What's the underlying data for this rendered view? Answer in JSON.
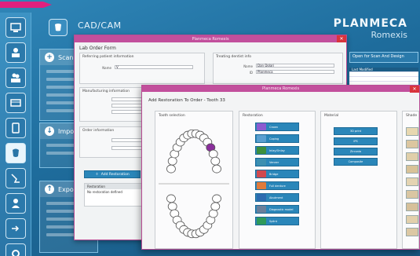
{
  "header": {
    "app_title": "CAD/CAM",
    "brand_line1": "PLANMECA",
    "brand_line2": "Romexis"
  },
  "sections": [
    {
      "label": "Scan"
    },
    {
      "label": "Impo"
    },
    {
      "label": "Expo"
    }
  ],
  "right_panel": {
    "bar_label": "Open for Scan And Design",
    "table_header": "Last Modified",
    "rows": [
      "",
      ""
    ]
  },
  "order_dialog": {
    "title": "Planmeca Romexis",
    "subtitle": "Lab Order Form",
    "group_patient": "Referring patient information",
    "group_patient_field": "Name",
    "group_patient_value": "V",
    "group_dentist": "Treating dentist info",
    "group_dentist_fields": [
      "Name",
      "ID"
    ],
    "group_dentist_values": [
      "Dan Dolari",
      "Planmeca"
    ],
    "group_manufacturing": "Manufacturing information",
    "group_delivery": "Order information",
    "add_button": "Add Restoration",
    "table_header": "Restoration",
    "table_row": "No restoration defined"
  },
  "restoration_dialog": {
    "title": "Planmeca Romexis",
    "subtitle": "Add Restoration To Order - Tooth 33",
    "col_tooth": "Tooth selection",
    "col_restoration": "Restoration",
    "col_material": "Material",
    "col_shade": "Shade",
    "restorations": [
      {
        "label": "Crown",
        "color": "#8c5bd0"
      },
      {
        "label": "Coping",
        "color": "#5a9fd0"
      },
      {
        "label": "Inlay/Onlay",
        "color": "#3c8f3c"
      },
      {
        "label": "Veneer",
        "color": "#3c8fb0"
      },
      {
        "label": "Bridge",
        "color": "#d0494f"
      },
      {
        "label": "Full denture",
        "color": "#e07a3a"
      },
      {
        "label": "Abutment",
        "color": "#2c6bb0"
      },
      {
        "label": "Diagnostic model",
        "color": "#6a7f9a"
      },
      {
        "label": "Splint",
        "color": "#2f9a5a"
      }
    ],
    "materials": [
      "3D print",
      "IPS",
      "Zirconia",
      "Composite"
    ],
    "selected_tooth_color": "#8b2e9c"
  }
}
